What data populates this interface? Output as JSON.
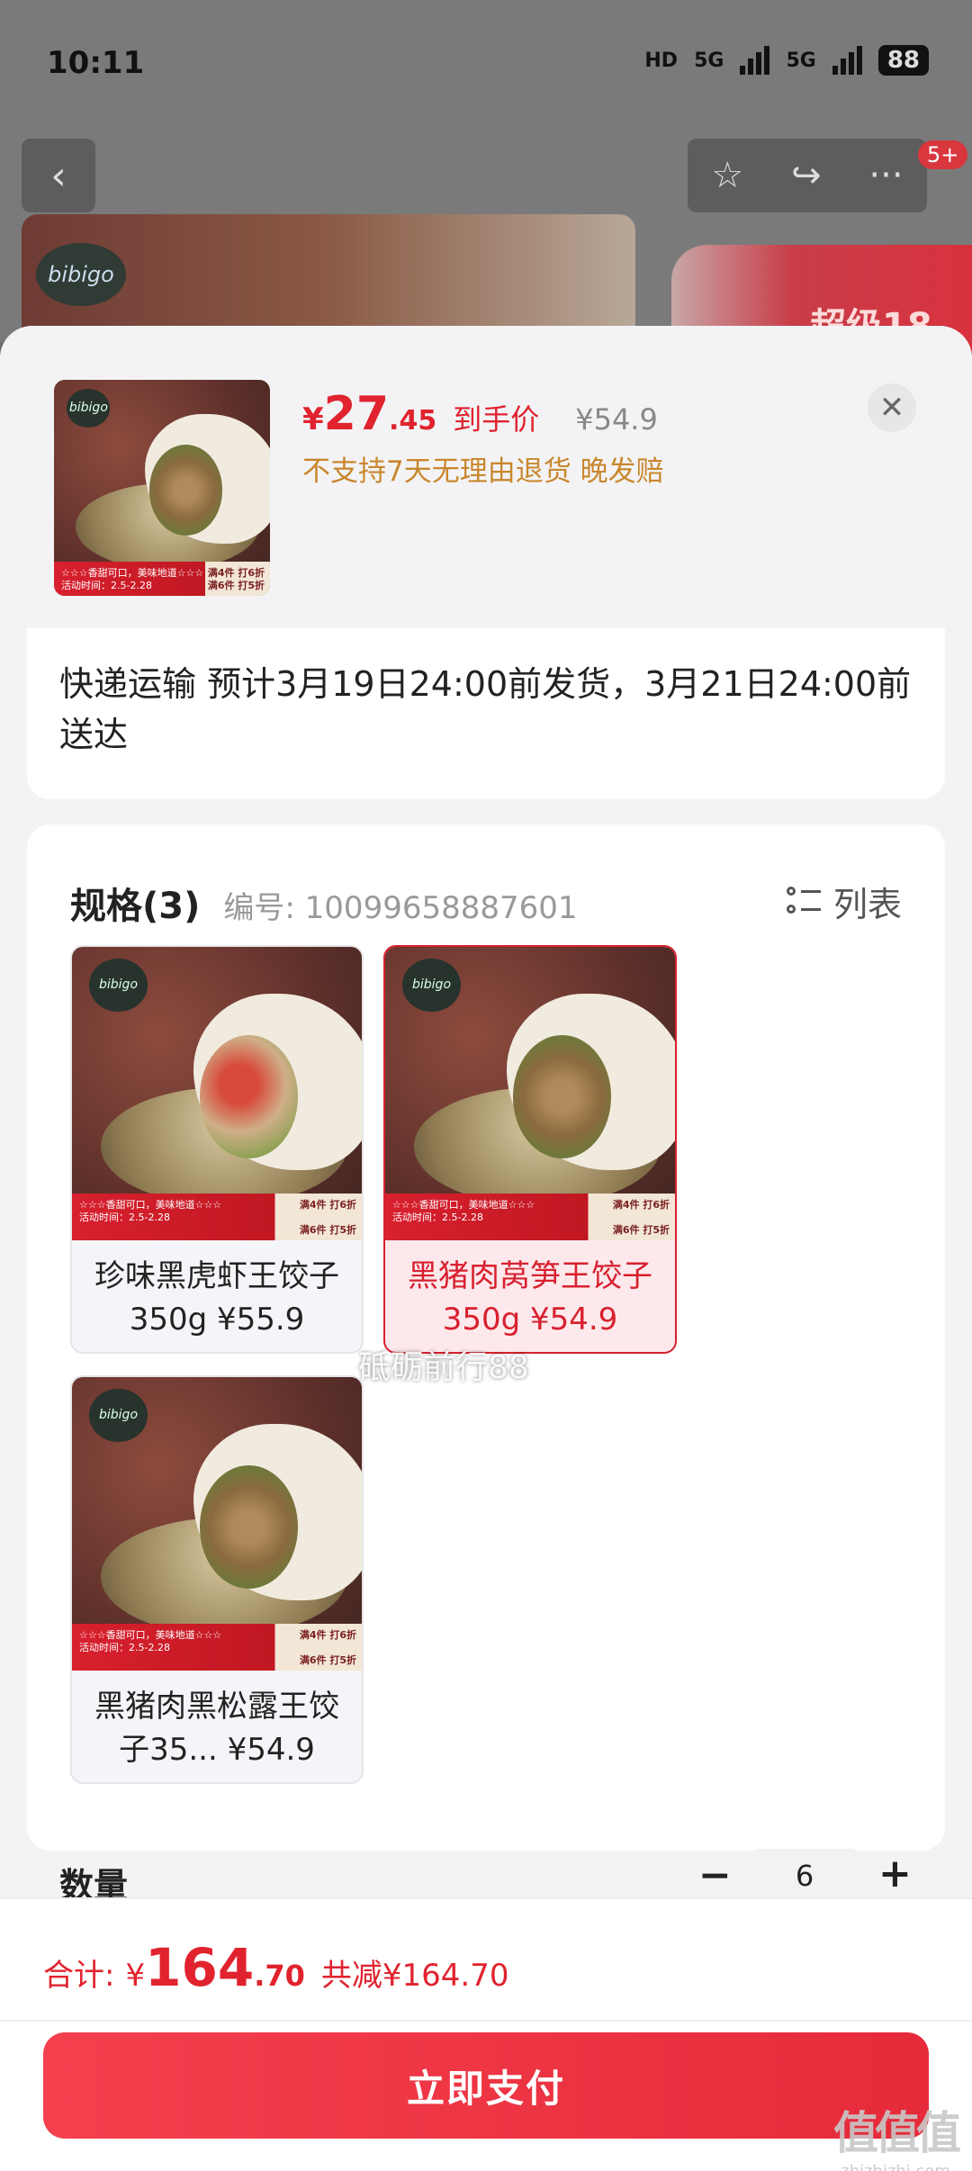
{
  "status_bar": {
    "time": "10:11",
    "network": "HD",
    "signal_1": "5G",
    "signal_2": "5G",
    "battery": "88"
  },
  "nav": {
    "badge": "5+"
  },
  "banner": {
    "brand": "bibigo",
    "promo_text": "超级18"
  },
  "product": {
    "price_yen": "¥",
    "price_int": "27",
    "price_dec": ".45",
    "price_tag": "到手价",
    "original_price": "¥54.9",
    "note": "不支持7天无理由退货  晚发赔",
    "thumb_brand": "bibigo",
    "thumb_strip_1": "☆☆☆香甜可口，美味地道☆☆☆",
    "thumb_strip_2": "活动时间：2.5-2.28",
    "thumb_strip_r1": "满4件 打6折",
    "thumb_strip_r2": "满6件 打5折"
  },
  "shipping": {
    "text": "快递运输 预计3月19日24:00前发货，3月21日24:00前送达"
  },
  "spec": {
    "title": "规格(3)",
    "code": "编号: 10099658887601",
    "list_label": "列表",
    "options": [
      {
        "line1": "珍味黑虎虾王饺子",
        "line2": "350g ¥55.9",
        "selected": false
      },
      {
        "line1": "黑猪肉莴笋王饺子",
        "line2": "350g ¥54.9",
        "selected": true
      },
      {
        "line1": "黑猪肉黑松露王饺",
        "line2": "子35... ¥54.9",
        "selected": false
      }
    ]
  },
  "watermark": "砥砺前行88",
  "quantity": {
    "label": "数量",
    "minus": "−",
    "value": "6",
    "plus": "+"
  },
  "footer": {
    "total_label": "合计:",
    "total_yen": "¥",
    "total_int": "164",
    "total_dec": ".70",
    "total_save": "共减¥164.70",
    "pay_label": "立即支付",
    "site_big": "值值值",
    "site_small": "zhizhizhi.com"
  }
}
